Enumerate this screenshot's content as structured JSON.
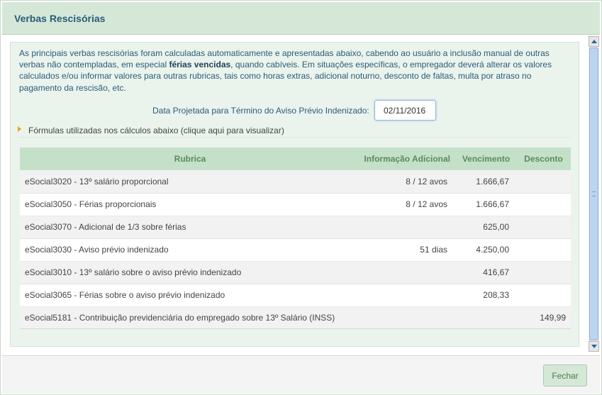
{
  "dialog": {
    "title": "Verbas Rescisórias"
  },
  "intro": {
    "text_before": "As principais verbas rescisórias foram calculadas automaticamente e apresentadas abaixo, cabendo ao usuário a inclusão manual de outras verbas não contempladas, em especial ",
    "text_bold": "férias vencidas",
    "text_after": ", quando cabíveis. Em situações específicas, o empregador deverá alterar os valores calculados e/ou informar valores para outras rubricas, tais como horas extras, adicional noturno, desconto de faltas, multa por atraso no pagamento da rescisão, etc."
  },
  "date_field": {
    "label": "Data Projetada para Término do Aviso Prévio Indenizado:",
    "value": "02/11/2016"
  },
  "formulas": {
    "label": "Fórmulas utilizadas nos cálculos abaixo (clique aqui para visualizar)",
    "icon": "triangle-right-icon"
  },
  "table": {
    "headers": {
      "rubrica": "Rubrica",
      "info": "Informação Adicional",
      "vencimento": "Vencimento",
      "desconto": "Desconto"
    },
    "rows": [
      {
        "rubrica": "eSocial3020 - 13º salário proporcional",
        "info": "8 / 12 avos",
        "vencimento": "1.666,67",
        "desconto": ""
      },
      {
        "rubrica": "eSocial3050 - Férias proporcionais",
        "info": "8 / 12 avos",
        "vencimento": "1.666,67",
        "desconto": ""
      },
      {
        "rubrica": "eSocial3070 - Adicional de 1/3 sobre férias",
        "info": "",
        "vencimento": "625,00",
        "desconto": ""
      },
      {
        "rubrica": "eSocial3030 - Aviso prévio indenizado",
        "info": "51 dias",
        "vencimento": "4.250,00",
        "desconto": ""
      },
      {
        "rubrica": "eSocial3010 - 13º salário sobre o aviso prévio indenizado",
        "info": "",
        "vencimento": "416,67",
        "desconto": ""
      },
      {
        "rubrica": "eSocial3065 - Férias sobre o aviso prévio indenizado",
        "info": "",
        "vencimento": "208,33",
        "desconto": ""
      },
      {
        "rubrica": "eSocial5181 - Contribuição previdenciária do empregado sobre 13º Salário (INSS)",
        "info": "",
        "vencimento": "",
        "desconto": "149,99"
      }
    ]
  },
  "footer": {
    "close_label": "Fechar"
  },
  "colors": {
    "header_bg": "#d5e8d7",
    "panel_bg": "#eaf4ec",
    "title_text": "#2c5a7a",
    "table_header_bg": "#c5e0c8",
    "table_header_text": "#5a8a5e",
    "accent_orange": "#f0a020"
  }
}
